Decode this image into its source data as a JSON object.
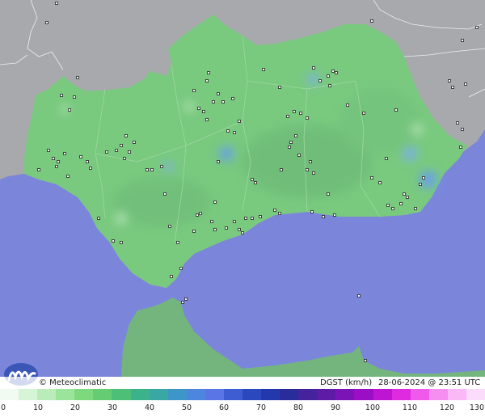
{
  "credit": "© Meteoclimatic",
  "variable": "DGST (km/h)",
  "timestamp": "28-06-2024 @ 23:51 UTC",
  "colors": {
    "sea": "#7b86db",
    "land_outside": "#a7a9ad",
    "land_region": "#79c97f",
    "land_region_dark": "#6fb976",
    "africa": "#74b57e"
  },
  "legend": {
    "ticks": [
      "0",
      "10",
      "20",
      "30",
      "40",
      "50",
      "60",
      "70",
      "80",
      "90",
      "100",
      "110",
      "120",
      "130"
    ],
    "colors": [
      "#f2fbf2",
      "#d6f4d6",
      "#b9ecb9",
      "#9be49b",
      "#7ed97e",
      "#66cc73",
      "#4ebf77",
      "#3cb28a",
      "#39a8a5",
      "#3e95c7",
      "#4c86de",
      "#5a76e6",
      "#3f5dd3",
      "#2c48bf",
      "#2438ad",
      "#2a2c9c",
      "#44239c",
      "#5e1ca6",
      "#7a14b6",
      "#9a0fc5",
      "#be15d2",
      "#de2be0",
      "#ef5aea",
      "#f68ef1",
      "#fab8f6",
      "#fcdcfb"
    ]
  }
}
